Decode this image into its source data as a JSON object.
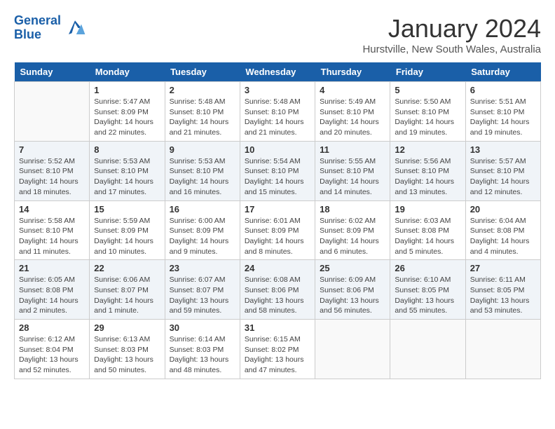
{
  "header": {
    "logo_line1": "General",
    "logo_line2": "Blue",
    "title": "January 2024",
    "subtitle": "Hurstville, New South Wales, Australia"
  },
  "days_of_week": [
    "Sunday",
    "Monday",
    "Tuesday",
    "Wednesday",
    "Thursday",
    "Friday",
    "Saturday"
  ],
  "weeks": [
    [
      {
        "day": "",
        "info": ""
      },
      {
        "day": "1",
        "info": "Sunrise: 5:47 AM\nSunset: 8:09 PM\nDaylight: 14 hours\nand 22 minutes."
      },
      {
        "day": "2",
        "info": "Sunrise: 5:48 AM\nSunset: 8:10 PM\nDaylight: 14 hours\nand 21 minutes."
      },
      {
        "day": "3",
        "info": "Sunrise: 5:48 AM\nSunset: 8:10 PM\nDaylight: 14 hours\nand 21 minutes."
      },
      {
        "day": "4",
        "info": "Sunrise: 5:49 AM\nSunset: 8:10 PM\nDaylight: 14 hours\nand 20 minutes."
      },
      {
        "day": "5",
        "info": "Sunrise: 5:50 AM\nSunset: 8:10 PM\nDaylight: 14 hours\nand 19 minutes."
      },
      {
        "day": "6",
        "info": "Sunrise: 5:51 AM\nSunset: 8:10 PM\nDaylight: 14 hours\nand 19 minutes."
      }
    ],
    [
      {
        "day": "7",
        "info": "Sunrise: 5:52 AM\nSunset: 8:10 PM\nDaylight: 14 hours\nand 18 minutes."
      },
      {
        "day": "8",
        "info": "Sunrise: 5:53 AM\nSunset: 8:10 PM\nDaylight: 14 hours\nand 17 minutes."
      },
      {
        "day": "9",
        "info": "Sunrise: 5:53 AM\nSunset: 8:10 PM\nDaylight: 14 hours\nand 16 minutes."
      },
      {
        "day": "10",
        "info": "Sunrise: 5:54 AM\nSunset: 8:10 PM\nDaylight: 14 hours\nand 15 minutes."
      },
      {
        "day": "11",
        "info": "Sunrise: 5:55 AM\nSunset: 8:10 PM\nDaylight: 14 hours\nand 14 minutes."
      },
      {
        "day": "12",
        "info": "Sunrise: 5:56 AM\nSunset: 8:10 PM\nDaylight: 14 hours\nand 13 minutes."
      },
      {
        "day": "13",
        "info": "Sunrise: 5:57 AM\nSunset: 8:10 PM\nDaylight: 14 hours\nand 12 minutes."
      }
    ],
    [
      {
        "day": "14",
        "info": "Sunrise: 5:58 AM\nSunset: 8:10 PM\nDaylight: 14 hours\nand 11 minutes."
      },
      {
        "day": "15",
        "info": "Sunrise: 5:59 AM\nSunset: 8:09 PM\nDaylight: 14 hours\nand 10 minutes."
      },
      {
        "day": "16",
        "info": "Sunrise: 6:00 AM\nSunset: 8:09 PM\nDaylight: 14 hours\nand 9 minutes."
      },
      {
        "day": "17",
        "info": "Sunrise: 6:01 AM\nSunset: 8:09 PM\nDaylight: 14 hours\nand 8 minutes."
      },
      {
        "day": "18",
        "info": "Sunrise: 6:02 AM\nSunset: 8:09 PM\nDaylight: 14 hours\nand 6 minutes."
      },
      {
        "day": "19",
        "info": "Sunrise: 6:03 AM\nSunset: 8:08 PM\nDaylight: 14 hours\nand 5 minutes."
      },
      {
        "day": "20",
        "info": "Sunrise: 6:04 AM\nSunset: 8:08 PM\nDaylight: 14 hours\nand 4 minutes."
      }
    ],
    [
      {
        "day": "21",
        "info": "Sunrise: 6:05 AM\nSunset: 8:08 PM\nDaylight: 14 hours\nand 2 minutes."
      },
      {
        "day": "22",
        "info": "Sunrise: 6:06 AM\nSunset: 8:07 PM\nDaylight: 14 hours\nand 1 minute."
      },
      {
        "day": "23",
        "info": "Sunrise: 6:07 AM\nSunset: 8:07 PM\nDaylight: 13 hours\nand 59 minutes."
      },
      {
        "day": "24",
        "info": "Sunrise: 6:08 AM\nSunset: 8:06 PM\nDaylight: 13 hours\nand 58 minutes."
      },
      {
        "day": "25",
        "info": "Sunrise: 6:09 AM\nSunset: 8:06 PM\nDaylight: 13 hours\nand 56 minutes."
      },
      {
        "day": "26",
        "info": "Sunrise: 6:10 AM\nSunset: 8:05 PM\nDaylight: 13 hours\nand 55 minutes."
      },
      {
        "day": "27",
        "info": "Sunrise: 6:11 AM\nSunset: 8:05 PM\nDaylight: 13 hours\nand 53 minutes."
      }
    ],
    [
      {
        "day": "28",
        "info": "Sunrise: 6:12 AM\nSunset: 8:04 PM\nDaylight: 13 hours\nand 52 minutes."
      },
      {
        "day": "29",
        "info": "Sunrise: 6:13 AM\nSunset: 8:03 PM\nDaylight: 13 hours\nand 50 minutes."
      },
      {
        "day": "30",
        "info": "Sunrise: 6:14 AM\nSunset: 8:03 PM\nDaylight: 13 hours\nand 48 minutes."
      },
      {
        "day": "31",
        "info": "Sunrise: 6:15 AM\nSunset: 8:02 PM\nDaylight: 13 hours\nand 47 minutes."
      },
      {
        "day": "",
        "info": ""
      },
      {
        "day": "",
        "info": ""
      },
      {
        "day": "",
        "info": ""
      }
    ]
  ]
}
